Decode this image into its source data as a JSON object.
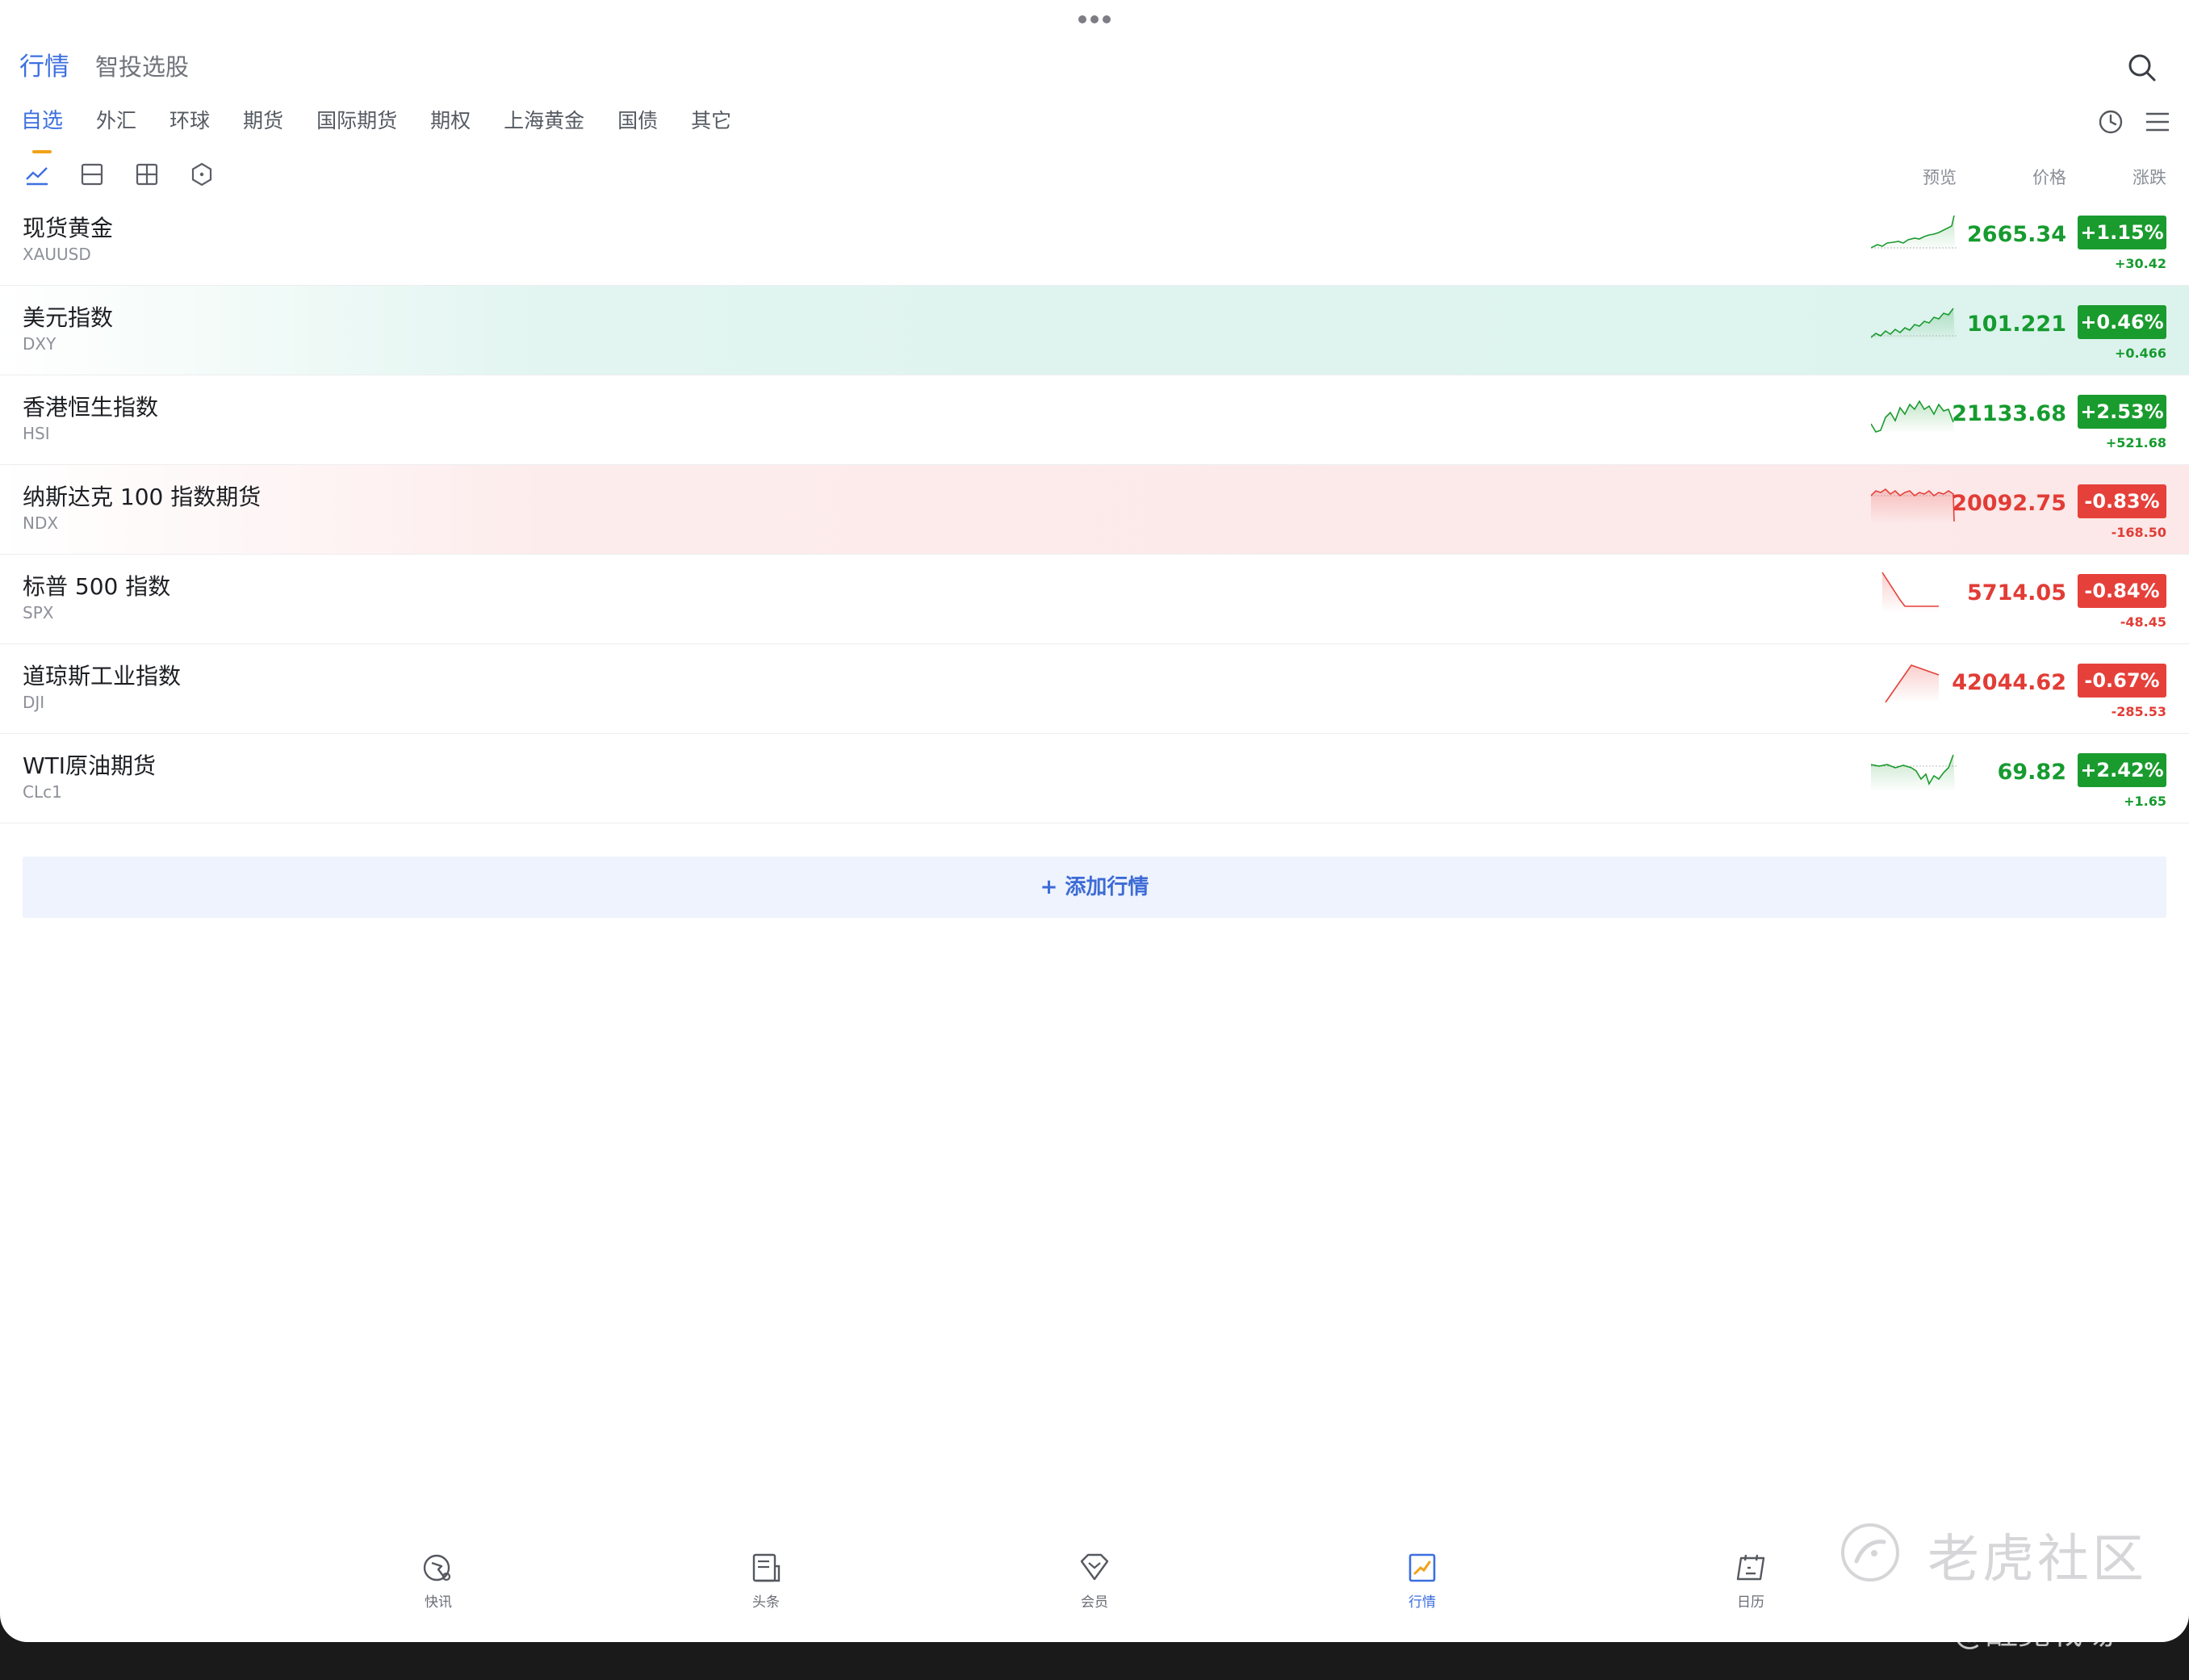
{
  "header": {
    "tabs": [
      {
        "label": "行情",
        "active": true
      },
      {
        "label": "智投选股",
        "active": false
      }
    ]
  },
  "sub_tabs": [
    "自选",
    "外汇",
    "环球",
    "期货",
    "国际期货",
    "期权",
    "上海黄金",
    "国债",
    "其它"
  ],
  "columns": {
    "preview": "预览",
    "price": "价格",
    "change": "涨跌"
  },
  "rows": [
    {
      "name": "现货黄金",
      "code": "XAUUSD",
      "price": "2665.34",
      "pct": "+1.15%",
      "chg": "+30.42",
      "dir": "up"
    },
    {
      "name": "美元指数",
      "code": "DXY",
      "price": "101.221",
      "pct": "+0.46%",
      "chg": "+0.466",
      "dir": "up"
    },
    {
      "name": "香港恒生指数",
      "code": "HSI",
      "price": "21133.68",
      "pct": "+2.53%",
      "chg": "+521.68",
      "dir": "up"
    },
    {
      "name": "纳斯达克 100 指数期货",
      "code": "NDX",
      "price": "20092.75",
      "pct": "-0.83%",
      "chg": "-168.50",
      "dir": "down"
    },
    {
      "name": "标普 500 指数",
      "code": "SPX",
      "price": "5714.05",
      "pct": "-0.84%",
      "chg": "-48.45",
      "dir": "down"
    },
    {
      "name": "道琼斯工业指数",
      "code": "DJI",
      "price": "42044.62",
      "pct": "-0.67%",
      "chg": "-285.53",
      "dir": "down"
    },
    {
      "name": "WTI原油期货",
      "code": "CLc1",
      "price": "69.82",
      "pct": "+2.42%",
      "chg": "+1.65",
      "dir": "up"
    }
  ],
  "add_button": "+ 添加行情",
  "bottom_nav": [
    {
      "label": "快讯",
      "icon": "flash-news-icon"
    },
    {
      "label": "头条",
      "icon": "headline-icon"
    },
    {
      "label": "会员",
      "icon": "diamond-icon"
    },
    {
      "label": "行情",
      "icon": "market-chart-icon"
    },
    {
      "label": "日历",
      "icon": "calendar-icon"
    }
  ],
  "watermark": {
    "brand": "老虎社区",
    "user": "@醒覺戰場"
  },
  "colors": {
    "accent": "#3c6fe0",
    "up": "#1a9b2e",
    "down": "#e6403a",
    "underline": "#f0a21a"
  }
}
